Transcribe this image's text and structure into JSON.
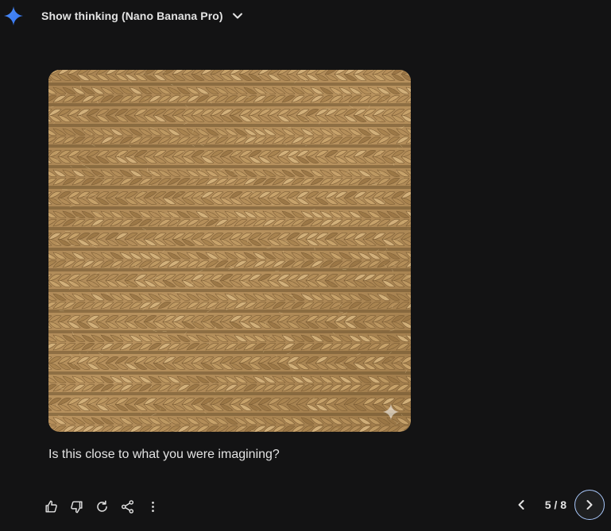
{
  "header": {
    "thinking_label": "Show thinking (Nano Banana Pro)",
    "logo_icon": "gemini-sparkle-icon",
    "chevron_icon": "chevron-down-icon"
  },
  "image": {
    "description_icon": "generated-image",
    "watermark_icon": "sparkle-watermark-icon"
  },
  "response": {
    "text": "Is this close to what you were imagining?"
  },
  "actions": [
    {
      "name": "thumbs-up-icon"
    },
    {
      "name": "thumbs-down-icon"
    },
    {
      "name": "regenerate-icon"
    },
    {
      "name": "share-icon"
    },
    {
      "name": "more-options-icon"
    }
  ],
  "pager": {
    "label": "5 / 8",
    "prev_icon": "chevron-left-icon",
    "next_icon": "chevron-right-icon"
  },
  "colors": {
    "background": "#131314",
    "text": "#e3e3e3",
    "accent": "#a8c7fa",
    "logo": "#4796e3"
  }
}
